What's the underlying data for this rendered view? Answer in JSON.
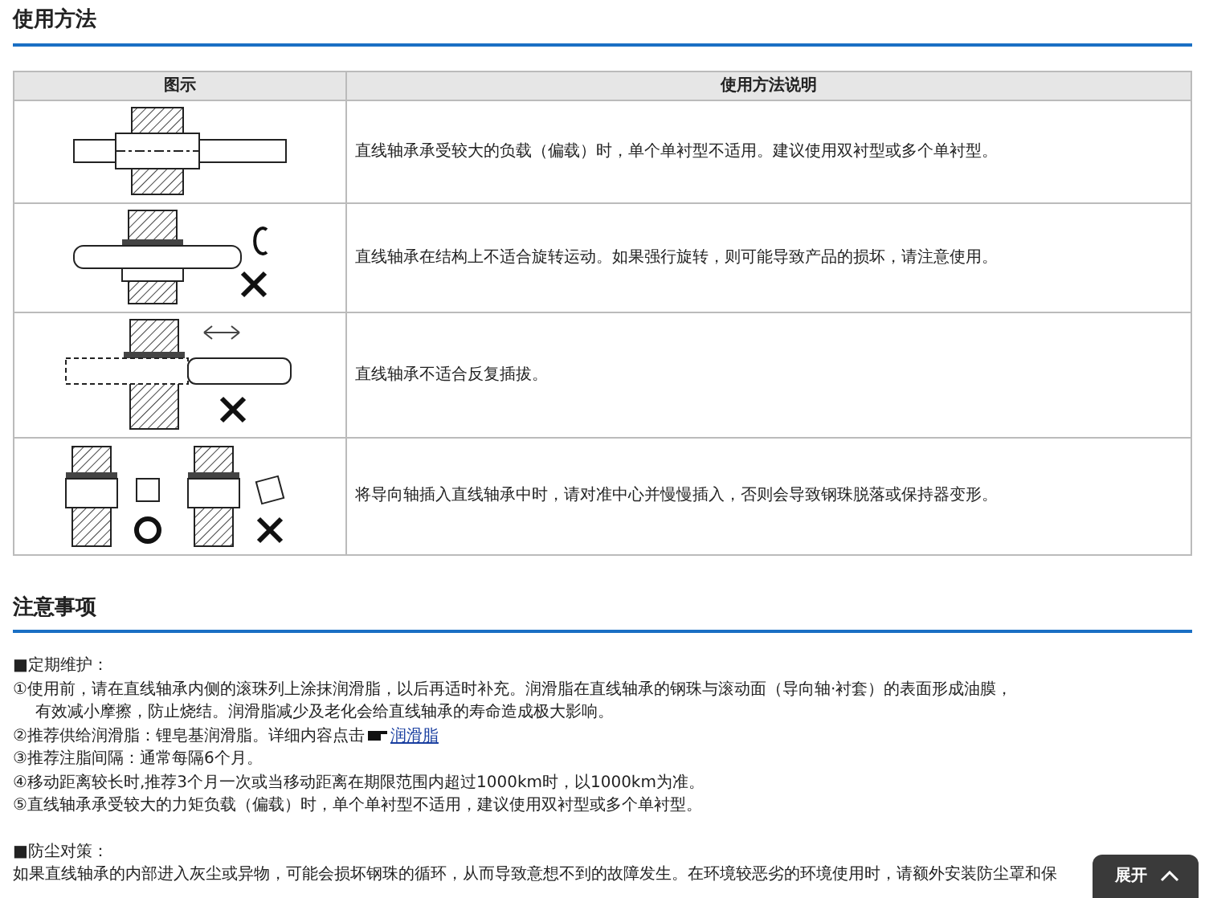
{
  "usage": {
    "title": "使用方法",
    "columns": [
      "图示",
      "使用方法说明"
    ],
    "rows": [
      {
        "kind": "offset_load",
        "text": "直线轴承承受较大的负载（偏载）时，单个单衬型不适用。建议使用双衬型或多个单衬型。"
      },
      {
        "kind": "rotation",
        "text": "直线轴承在结构上不适合旋转运动。如果强行旋转，则可能导致产品的损坏，请注意使用。"
      },
      {
        "kind": "insertion",
        "text": "直线轴承不适合反复插拔。"
      },
      {
        "kind": "alignment",
        "text": "将导向轴插入直线轴承中时，请对准中心并慢慢插入，否则会导致钢珠脱落或保持器变形。"
      }
    ]
  },
  "notes": {
    "title": "注意事项",
    "groups": [
      {
        "heading": "■定期维护：",
        "lines": [
          {
            "kind": "item",
            "text": "①使用前，请在直线轴承内侧的滚珠列上涂抹润滑脂，以后再适时补充。润滑脂在直线轴承的钢珠与滚动面（导向轴·衬套）的表面形成油膜，"
          },
          {
            "kind": "continuation",
            "text": "有效减小摩擦，防止烧结。润滑脂减少及老化会给直线轴承的寿命造成极大影响。"
          },
          {
            "kind": "item",
            "text": "②推荐供给润滑脂：锂皂基润滑脂。详细内容点击",
            "link": "润滑脂"
          },
          {
            "kind": "item",
            "text": "③推荐注脂间隔：通常每隔6个月。"
          },
          {
            "kind": "item",
            "text": "④移动距离较长时,推荐3个月一次或当移动距离在期限范围内超过1000km时，以1000km为准。"
          },
          {
            "kind": "item",
            "text": "⑤直线轴承承受较大的力矩负载（偏载）时，单个单衬型不适用，建议使用双衬型或多个单衬型。"
          }
        ]
      },
      {
        "heading": "■防尘对策：",
        "lines": [
          {
            "kind": "item",
            "text": "如果直线轴承的内部进入灰尘或异物，可能会损坏钢珠的循环，从而导致意想不到的故障发生。在环境较恶劣的环境使用时，请额外安装防尘罩和保"
          }
        ]
      }
    ]
  },
  "expand_button": {
    "label": "展开"
  }
}
